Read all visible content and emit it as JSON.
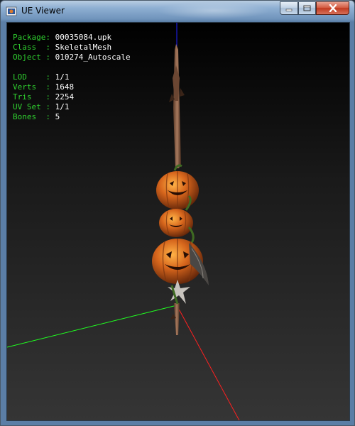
{
  "window": {
    "title": "UE Viewer"
  },
  "info": {
    "group1": [
      {
        "key": "Package:",
        "value": "00035084.upk"
      },
      {
        "key": "Class  :",
        "value": "SkeletalMesh"
      },
      {
        "key": "Object :",
        "value": "010274_Autoscale"
      }
    ],
    "group2": [
      {
        "key": "LOD    :",
        "value": "1/1"
      },
      {
        "key": "Verts  :",
        "value": "1648"
      },
      {
        "key": "Tris   :",
        "value": "2254"
      },
      {
        "key": "UV Set :",
        "value": "1/1"
      },
      {
        "key": "Bones  :",
        "value": "5"
      }
    ]
  },
  "colors": {
    "label": "#2fd02f",
    "value": "#ffffff",
    "axis_x": "#ff2020",
    "axis_y": "#20ff20",
    "axis_z": "#2020ff",
    "pumpkin": "#d0621a"
  },
  "icons": {
    "app": "ue-viewer-app-icon",
    "minimize": "minimize-icon",
    "maximize": "maximize-icon",
    "close": "close-icon"
  }
}
